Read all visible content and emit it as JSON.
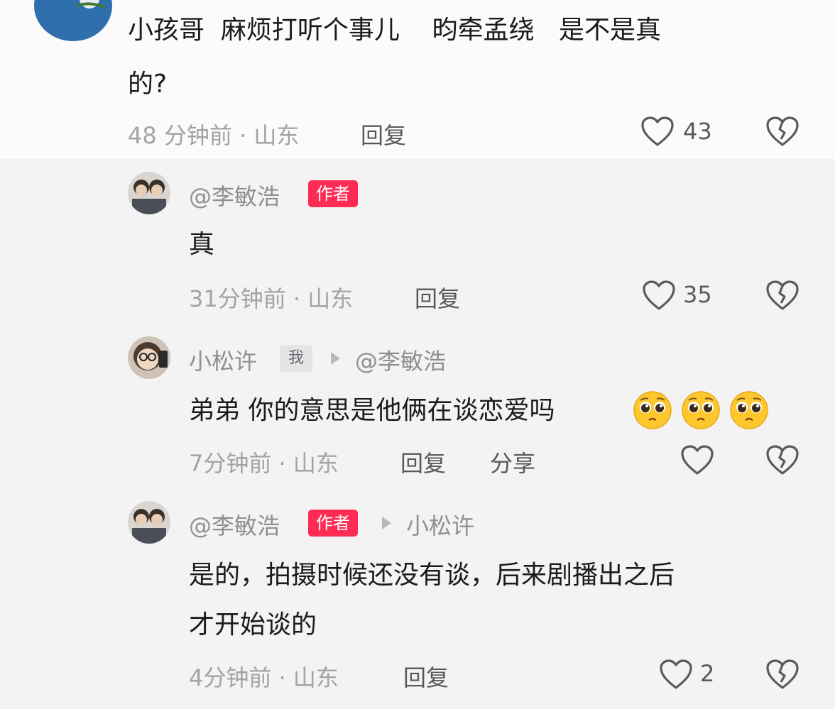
{
  "comment": {
    "text_line1": "小孩哥  麻烦打听个事儿    昀牵孟绕   是不是真",
    "text_line2": "的?",
    "time_location": "48 分钟前 · 山东",
    "reply_label": "回复",
    "like_count": "43"
  },
  "replies": [
    {
      "author": "@李敏浩",
      "author_tag": "作者",
      "text": "真",
      "time_location": "31分钟前 · 山东",
      "reply_label": "回复",
      "like_count": "35"
    },
    {
      "author": "小松许",
      "me_tag": "我",
      "reply_to": "@李敏浩",
      "text": "弟弟 你的意思是他俩在谈恋爱吗",
      "time_location": "7分钟前 · 山东",
      "reply_label": "回复",
      "share_label": "分享"
    },
    {
      "author": "@李敏浩",
      "author_tag": "作者",
      "reply_to": "小松许",
      "text_line1": "是的，拍摄时候还没有谈，后来剧播出之后",
      "text_line2": "才开始谈的",
      "time_location": "4分钟前 · 山东",
      "reply_label": "回复",
      "like_count": "2"
    }
  ],
  "colors": {
    "author_tag": "#fe2c55",
    "meta_gray": "#a3a3a6"
  },
  "icons": [
    "like-heart-icon",
    "dislike-broken-heart-icon",
    "pleading-face-emoji",
    "reply-arrow-icon"
  ]
}
